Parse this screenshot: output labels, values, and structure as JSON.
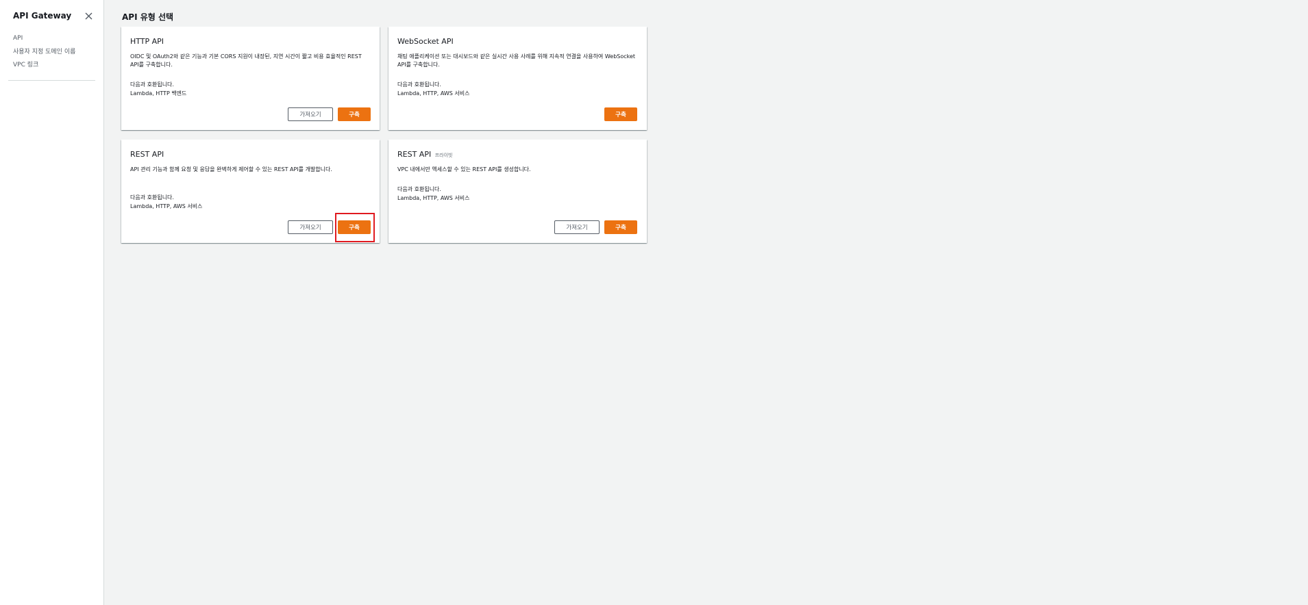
{
  "sidebar": {
    "title": "API Gateway",
    "close_icon": "close-icon",
    "items": [
      {
        "label": "API"
      },
      {
        "label": "사용자 지정 도메인 이름"
      },
      {
        "label": "VPC 링크"
      }
    ]
  },
  "page": {
    "title": "API 유형 선택"
  },
  "cards": [
    {
      "title": "HTTP API",
      "subtitle": "",
      "description": "OIDC 및 OAuth2와 같은 기능과 기본 CORS 지원이 내장된, 지연 시간이 짧고 비용 효율적인 REST API를 구축합니다.",
      "includes_label": "다음과 호환됩니다.",
      "includes_value": "Lambda, HTTP 백엔드",
      "import_label": "가져오기",
      "build_label": "구축"
    },
    {
      "title": "WebSocket API",
      "subtitle": "",
      "description": "채팅 애플리케이션 또는 대시보드와 같은 실시간 사용 사례를 위해 지속적 연결을 사용하여 WebSocket API를 구축합니다.",
      "includes_label": "다음과 호환됩니다.",
      "includes_value": "Lambda, HTTP, AWS 서비스",
      "build_label": "구축"
    },
    {
      "title": "REST API",
      "subtitle": "",
      "description": "API 관리 기능과 함께 요청 및 응답을 완벽하게 제어할 수 있는 REST API를 개발합니다.",
      "includes_label": "다음과 호환됩니다.",
      "includes_value": "Lambda, HTTP, AWS 서비스",
      "import_label": "가져오기",
      "build_label": "구축"
    },
    {
      "title": "REST API",
      "subtitle": "프라이빗",
      "description": "VPC 내에서만 액세스할 수 있는 REST API를 생성합니다.",
      "includes_label": "다음과 호환됩니다.",
      "includes_value": "Lambda, HTTP, AWS 서비스",
      "import_label": "가져오기",
      "build_label": "구축"
    }
  ],
  "colors": {
    "accent": "#ec7211",
    "highlight": "#e0191f",
    "background": "#f2f3f3"
  }
}
